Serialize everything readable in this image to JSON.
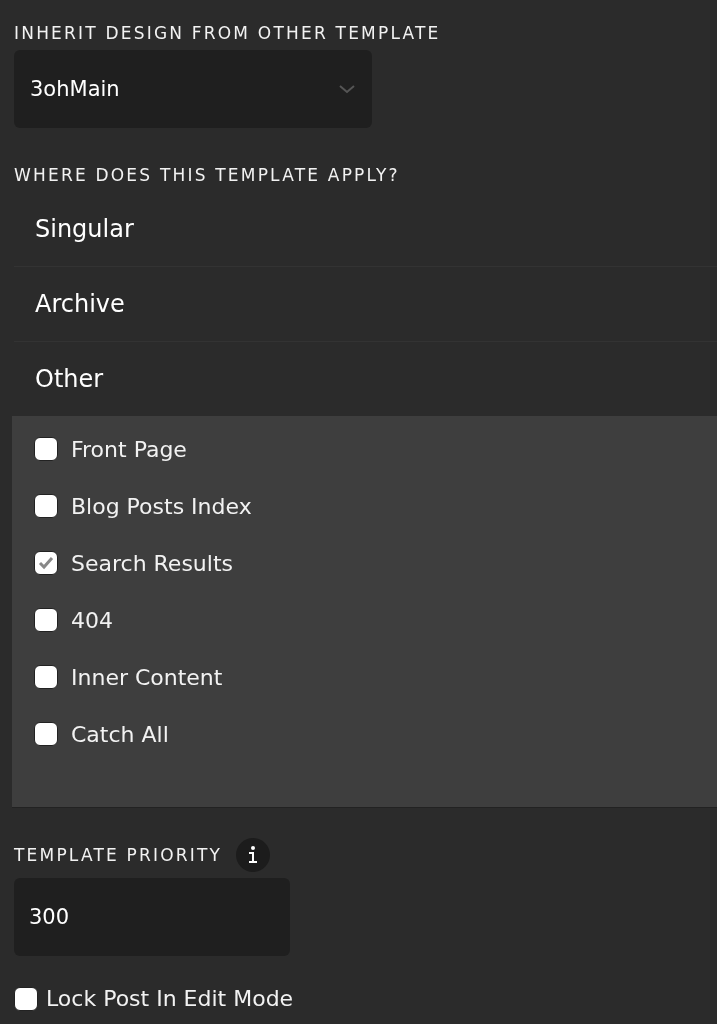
{
  "inherit": {
    "label": "INHERIT DESIGN FROM OTHER TEMPLATE",
    "value": "3ohMain"
  },
  "apply": {
    "label": "WHERE DOES THIS TEMPLATE APPLY?",
    "sections": [
      {
        "label": "Singular",
        "expanded": false
      },
      {
        "label": "Archive",
        "expanded": false
      },
      {
        "label": "Other",
        "expanded": true,
        "options": [
          {
            "label": "Front Page",
            "checked": false
          },
          {
            "label": "Blog Posts Index",
            "checked": false
          },
          {
            "label": "Search Results",
            "checked": true
          },
          {
            "label": "404",
            "checked": false
          },
          {
            "label": "Inner Content",
            "checked": false
          },
          {
            "label": "Catch All",
            "checked": false
          }
        ]
      }
    ]
  },
  "priority": {
    "label": "TEMPLATE PRIORITY",
    "value": "300"
  },
  "lock": {
    "label": "Lock Post In Edit Mode",
    "checked": false
  }
}
